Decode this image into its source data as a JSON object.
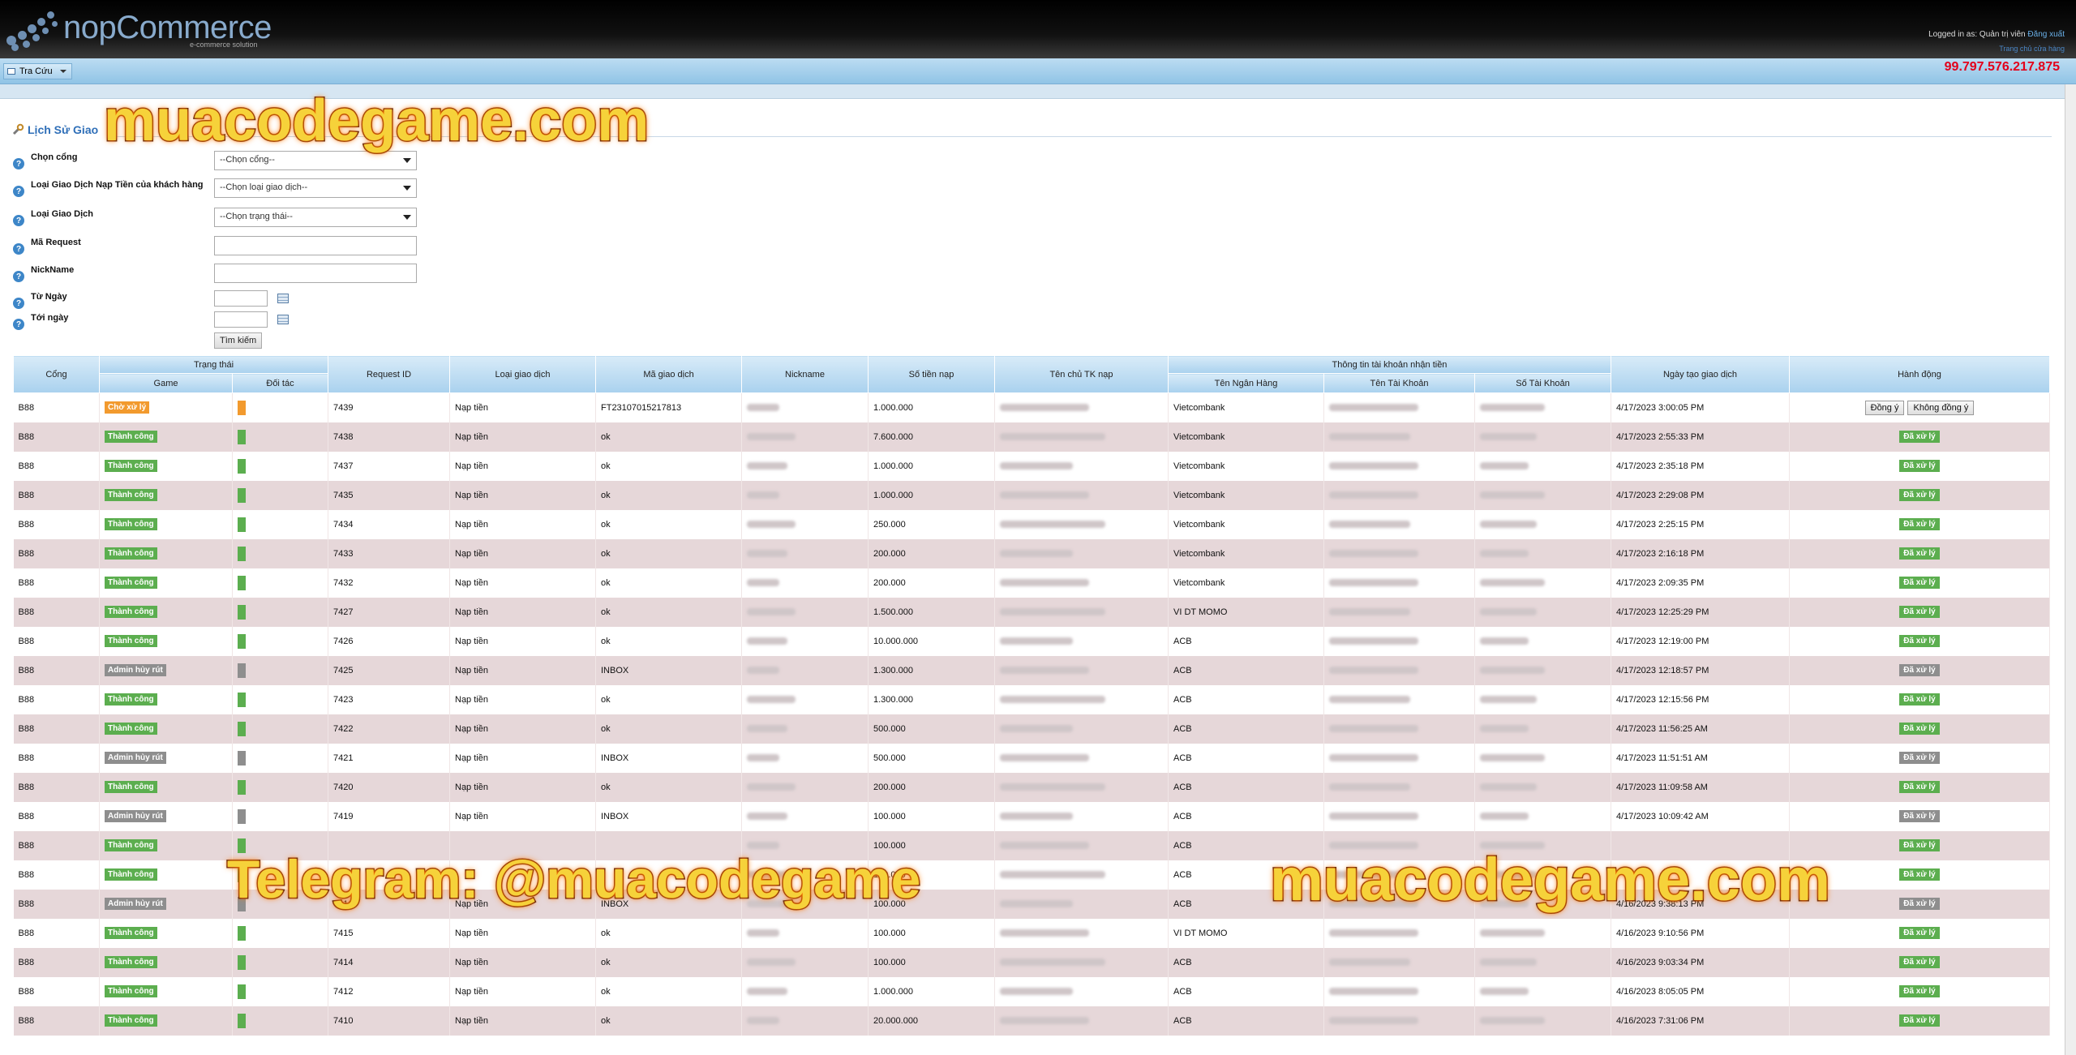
{
  "header": {
    "logo_text": "nopCommerce",
    "logo_sub": "e-commerce solution",
    "login_prefix": "Logged in as: Quản trị viên",
    "login_link": "Đăng xuất",
    "login_line2": "Trang chủ cửa hàng"
  },
  "menu": {
    "item1": "Tra Cứu"
  },
  "balance": "99.797.576.217.875",
  "page_title": "Lịch Sử Giao",
  "form": {
    "gate_label": "Chọn cổng",
    "gate_value": "--Chọn cổng--",
    "deposit_type_label": "Loại Giao Dịch Nạp Tiền của khách hàng",
    "deposit_type_value": "--Chọn loại giao dịch--",
    "tx_type_label": "Loại Giao Dịch",
    "tx_type_value": "--Chọn trạng thái--",
    "request_label": "Mã Request",
    "nick_label": "NickName",
    "from_label": "Từ Ngày",
    "to_label": "Tới ngày",
    "search_button": "Tìm kiếm"
  },
  "table": {
    "h_gate": "Cổng",
    "h_status": "Trạng thái",
    "h_game": "Game",
    "h_partner": "Đối tác",
    "h_request": "Request ID",
    "h_type": "Loại giao dịch",
    "h_code": "Mã giao dịch",
    "h_nick": "Nickname",
    "h_amount": "Số tiền nạp",
    "h_owner": "Tên chủ TK nạp",
    "h_bankinfo": "Thông tin tài khoản nhận tiền",
    "h_bank": "Tên Ngân Hàng",
    "h_accname": "Tên Tài Khoản",
    "h_accno": "Số Tài Khoản",
    "h_date": "Ngày tạo giao dịch",
    "h_action": "Hành động",
    "btn_approve": "Đồng ý",
    "btn_reject": "Không đồng ý",
    "rows": [
      {
        "gate": "B88",
        "status": "Chờ xử lý",
        "kind": "orange",
        "req": "7439",
        "type": "Nạp tiền",
        "code": "FT23107015217813",
        "amount": "1.000.000",
        "bank": "Vietcombank",
        "date": "4/17/2023 3:00:05 PM",
        "action": ""
      },
      {
        "gate": "B88",
        "status": "Thành công",
        "kind": "green",
        "req": "7438",
        "type": "Nạp tiền",
        "code": "ok",
        "amount": "7.600.000",
        "bank": "Vietcombank",
        "date": "4/17/2023 2:55:33 PM",
        "action": "Đã xử lý"
      },
      {
        "gate": "B88",
        "status": "Thành công",
        "kind": "green",
        "req": "7437",
        "type": "Nạp tiền",
        "code": "ok",
        "amount": "1.000.000",
        "bank": "Vietcombank",
        "date": "4/17/2023 2:35:18 PM",
        "action": "Đã xử lý"
      },
      {
        "gate": "B88",
        "status": "Thành công",
        "kind": "green",
        "req": "7435",
        "type": "Nạp tiền",
        "code": "ok",
        "amount": "1.000.000",
        "bank": "Vietcombank",
        "date": "4/17/2023 2:29:08 PM",
        "action": "Đã xử lý"
      },
      {
        "gate": "B88",
        "status": "Thành công",
        "kind": "green",
        "req": "7434",
        "type": "Nạp tiền",
        "code": "ok",
        "amount": "250.000",
        "bank": "Vietcombank",
        "date": "4/17/2023 2:25:15 PM",
        "action": "Đã xử lý"
      },
      {
        "gate": "B88",
        "status": "Thành công",
        "kind": "green",
        "req": "7433",
        "type": "Nạp tiền",
        "code": "ok",
        "amount": "200.000",
        "bank": "Vietcombank",
        "date": "4/17/2023 2:16:18 PM",
        "action": "Đã xử lý"
      },
      {
        "gate": "B88",
        "status": "Thành công",
        "kind": "green",
        "req": "7432",
        "type": "Nạp tiền",
        "code": "ok",
        "amount": "200.000",
        "bank": "Vietcombank",
        "date": "4/17/2023 2:09:35 PM",
        "action": "Đã xử lý"
      },
      {
        "gate": "B88",
        "status": "Thành công",
        "kind": "green",
        "req": "7427",
        "type": "Nạp tiền",
        "code": "ok",
        "amount": "1.500.000",
        "bank": "VI DT MOMO",
        "date": "4/17/2023 12:25:29 PM",
        "action": "Đã xử lý"
      },
      {
        "gate": "B88",
        "status": "Thành công",
        "kind": "green",
        "req": "7426",
        "type": "Nạp tiền",
        "code": "ok",
        "amount": "10.000.000",
        "bank": "ACB",
        "date": "4/17/2023 12:19:00 PM",
        "action": "Đã xử lý"
      },
      {
        "gate": "B88",
        "status": "Admin hủy rút",
        "kind": "gray",
        "req": "7425",
        "type": "Nạp tiền",
        "code": "INBOX",
        "amount": "1.300.000",
        "bank": "ACB",
        "date": "4/17/2023 12:18:57 PM",
        "action": "Đã xử lý"
      },
      {
        "gate": "B88",
        "status": "Thành công",
        "kind": "green",
        "req": "7423",
        "type": "Nạp tiền",
        "code": "ok",
        "amount": "1.300.000",
        "bank": "ACB",
        "date": "4/17/2023 12:15:56 PM",
        "action": "Đã xử lý"
      },
      {
        "gate": "B88",
        "status": "Thành công",
        "kind": "green",
        "req": "7422",
        "type": "Nạp tiền",
        "code": "ok",
        "amount": "500.000",
        "bank": "ACB",
        "date": "4/17/2023 11:56:25 AM",
        "action": "Đã xử lý"
      },
      {
        "gate": "B88",
        "status": "Admin hủy rút",
        "kind": "gray",
        "req": "7421",
        "type": "Nạp tiền",
        "code": "INBOX",
        "amount": "500.000",
        "bank": "ACB",
        "date": "4/17/2023 11:51:51 AM",
        "action": "Đã xử lý"
      },
      {
        "gate": "B88",
        "status": "Thành công",
        "kind": "green",
        "req": "7420",
        "type": "Nạp tiền",
        "code": "ok",
        "amount": "200.000",
        "bank": "ACB",
        "date": "4/17/2023 11:09:58 AM",
        "action": "Đã xử lý"
      },
      {
        "gate": "B88",
        "status": "Admin hủy rút",
        "kind": "gray",
        "req": "7419",
        "type": "Nạp tiền",
        "code": "INBOX",
        "amount": "100.000",
        "bank": "ACB",
        "date": "4/17/2023 10:09:42 AM",
        "action": "Đã xử lý"
      },
      {
        "gate": "B88",
        "status": "Thành công",
        "kind": "green",
        "req": "",
        "type": "",
        "code": "",
        "amount": "100.000",
        "bank": "ACB",
        "date": "",
        "action": "Đã xử lý"
      },
      {
        "gate": "B88",
        "status": "Thành công",
        "kind": "green",
        "req": "",
        "type": "",
        "code": "",
        "amount": "169.000",
        "bank": "ACB",
        "date": "",
        "action": "Đã xử lý"
      },
      {
        "gate": "B88",
        "status": "Admin hủy rút",
        "kind": "gray",
        "req": "7416",
        "type": "Nạp tiền",
        "code": "INBOX",
        "amount": "100.000",
        "bank": "ACB",
        "date": "4/16/2023 9:38:13 PM",
        "action": "Đã xử lý"
      },
      {
        "gate": "B88",
        "status": "Thành công",
        "kind": "green",
        "req": "7415",
        "type": "Nạp tiền",
        "code": "ok",
        "amount": "100.000",
        "bank": "VI DT MOMO",
        "date": "4/16/2023 9:10:56 PM",
        "action": "Đã xử lý"
      },
      {
        "gate": "B88",
        "status": "Thành công",
        "kind": "green",
        "req": "7414",
        "type": "Nạp tiền",
        "code": "ok",
        "amount": "100.000",
        "bank": "ACB",
        "date": "4/16/2023 9:03:34 PM",
        "action": "Đã xử lý"
      },
      {
        "gate": "B88",
        "status": "Thành công",
        "kind": "green",
        "req": "7412",
        "type": "Nạp tiền",
        "code": "ok",
        "amount": "1.000.000",
        "bank": "ACB",
        "date": "4/16/2023 8:05:05 PM",
        "action": "Đã xử lý"
      },
      {
        "gate": "B88",
        "status": "Thành công",
        "kind": "green",
        "req": "7410",
        "type": "Nạp tiền",
        "code": "ok",
        "amount": "20.000.000",
        "bank": "ACB",
        "date": "4/16/2023 7:31:06 PM",
        "action": "Đã xử lý"
      }
    ]
  },
  "colors": {
    "green": "#5cae4f",
    "orange": "#f29a2e",
    "gray": "#8e8e8e"
  },
  "watermarks": {
    "top": "muacodegame.com",
    "bottom_left": "Telegram: @muacodegame",
    "bottom_right": "muacodegame.com"
  }
}
